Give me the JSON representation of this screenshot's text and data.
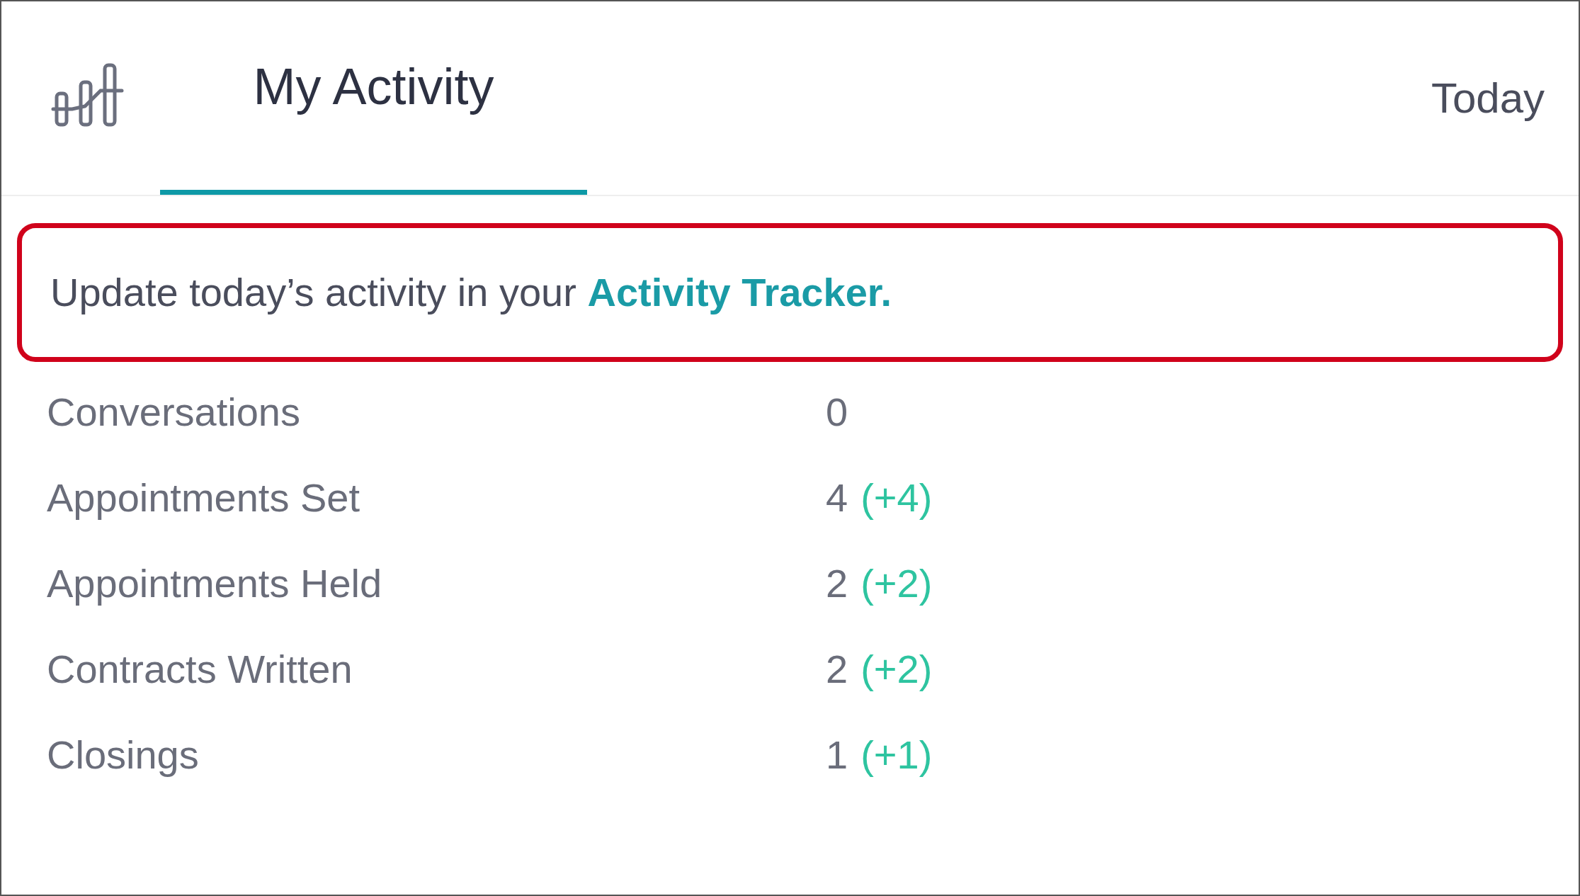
{
  "header": {
    "tab": {
      "label": "My Activity",
      "selected": true
    },
    "period": "Today"
  },
  "notice": {
    "text": "Update today’s activity in your ",
    "link": "Activity Tracker.",
    "highlighted": true
  },
  "rows": [
    {
      "label": "Conversations",
      "value": "0"
    },
    {
      "label": "Appointments Set",
      "value": "4",
      "change": "(+4)"
    },
    {
      "label": "Appointments Held",
      "value": "2",
      "change": "(+2)"
    },
    {
      "label": "Contracts Written",
      "value": "2",
      "change": "(+2)"
    },
    {
      "label": "Closings",
      "value": "1",
      "change": "(+1)"
    }
  ]
}
